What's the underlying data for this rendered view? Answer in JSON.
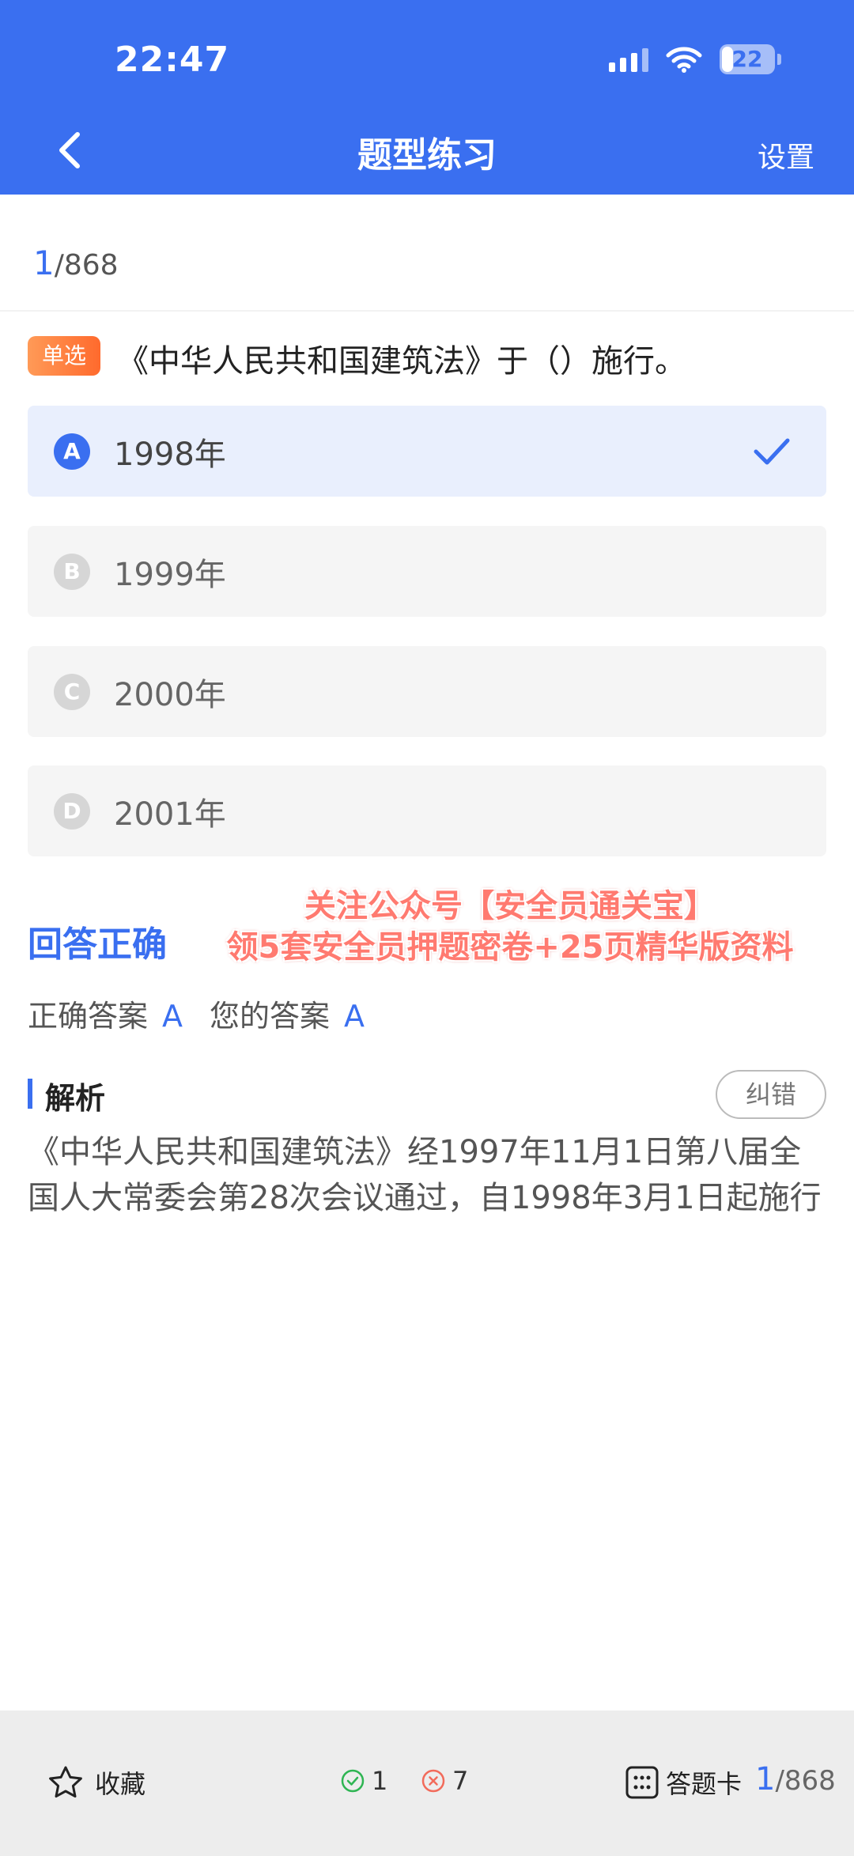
{
  "status_bar": {
    "time": "22:47",
    "battery": "22",
    "battery_level": 0.22
  },
  "nav": {
    "title": "题型练习",
    "settings_label": "设置"
  },
  "progress": {
    "current": "1",
    "total": "/868"
  },
  "question": {
    "type_tag": "单选",
    "text": "《中华人民共和国建筑法》于（）施行。",
    "options": [
      {
        "letter": "A",
        "text": "1998年",
        "selected": true
      },
      {
        "letter": "B",
        "text": "1999年",
        "selected": false
      },
      {
        "letter": "C",
        "text": "2000年",
        "selected": false
      },
      {
        "letter": "D",
        "text": "2001年",
        "selected": false
      }
    ]
  },
  "result": {
    "status": "回答正确",
    "correct_label": "正确答案",
    "correct_value": "A",
    "yours_label": "您的答案",
    "yours_value": "A"
  },
  "watermark": {
    "line1": "关注公众号【安全员通关宝】",
    "line2": "领5套安全员押题密卷+25页精华版资料"
  },
  "analysis": {
    "label": "解析",
    "report_label": "纠错",
    "text": "《中华人民共和国建筑法》经1997年11月1日第八届全国人大常委会第28次会议通过，自1998年3月1日起施行"
  },
  "bottom_bar": {
    "favorite_label": "收藏",
    "correct_count": "1",
    "wrong_count": "7",
    "answer_card_label": "答题卡",
    "current": "1",
    "total": "/868"
  },
  "colors": {
    "accent": "#3a6ff0",
    "tag": "#ff7a3d",
    "correct": "#2fb553",
    "wrong": "#f26b5b"
  }
}
